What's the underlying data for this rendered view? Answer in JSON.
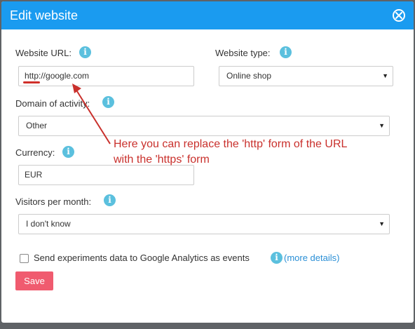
{
  "dialog": {
    "title": "Edit website"
  },
  "form": {
    "website_url": {
      "label": "Website URL:",
      "value": "http://google.com"
    },
    "website_type": {
      "label": "Website type:",
      "value": "Online shop"
    },
    "domain": {
      "label": "Domain of activity:",
      "value": "Other"
    },
    "currency": {
      "label": "Currency:",
      "value": "EUR"
    },
    "visitors": {
      "label": "Visitors per month:",
      "value": "I don't know"
    },
    "analytics": {
      "label": "Send experiments data to Google Analytics as events",
      "link": "(more details)",
      "checked": false
    },
    "save_label": "Save"
  },
  "annotation": {
    "line1": "Here you can replace the 'http' form of the URL",
    "line2": "with the 'https' form"
  },
  "colors": {
    "header": "#1a9bf0",
    "info_icon": "#5bc0de",
    "save_button": "#f05b6f",
    "annotation": "#c9302c",
    "link": "#2a8fd6"
  }
}
